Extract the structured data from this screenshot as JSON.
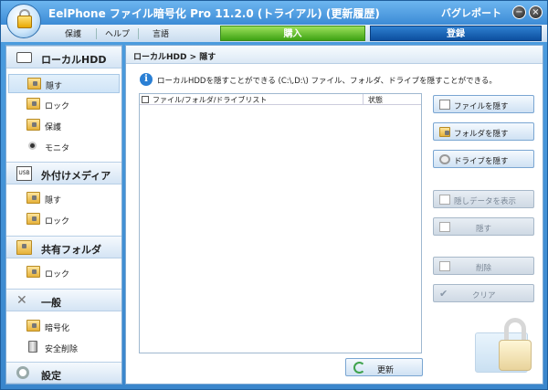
{
  "app": {
    "title": "EelPhone ファイル暗号化 Pro 11.2.0 (トライアル) (更新履歴)",
    "report_link": "バグレポート"
  },
  "window_controls": {
    "minimize": "−",
    "close": "×"
  },
  "menu": {
    "items": [
      "保護",
      "ヘルプ",
      "言語"
    ],
    "buy": "購入",
    "register": "登録"
  },
  "sidebar": {
    "sections": [
      {
        "label": "ローカルHDD",
        "items": [
          "隠す",
          "ロック",
          "保護",
          "モニタ"
        ]
      },
      {
        "label": "外付けメディア",
        "items": [
          "隠す",
          "ロック"
        ]
      },
      {
        "label": "共有フォルダ",
        "items": [
          "ロック"
        ]
      },
      {
        "label": "一般",
        "items": [
          "暗号化",
          "安全削除"
        ]
      },
      {
        "label": "設定",
        "items": []
      }
    ]
  },
  "content": {
    "breadcrumb": "ローカルHDD > 隠す",
    "description": "ローカルHDDを隠すことができる (C:\\,D:\\) ファイル、フォルダ、ドライブを隠すことができる。",
    "list": {
      "col_path": "ファイル/フォルダ/ドライブリスト",
      "col_status": "状態"
    },
    "buttons": {
      "hide_file": "ファイルを隠す",
      "hide_folder": "フォルダを隠す",
      "hide_drive": "ドライブを隠す",
      "show_hidden": "隠しデータを表示",
      "hide": "隠す",
      "delete": "削除",
      "clear": "クリア",
      "refresh": "更新"
    }
  }
}
